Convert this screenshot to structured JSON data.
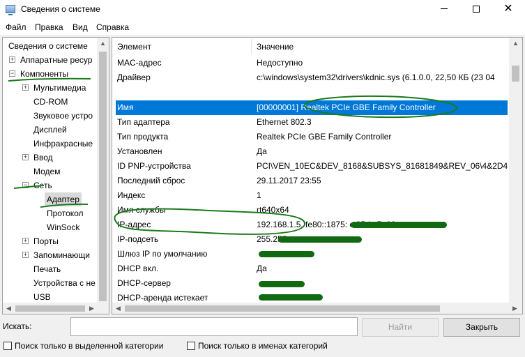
{
  "window": {
    "title": "Сведения о системе"
  },
  "menu": [
    "Файл",
    "Правка",
    "Вид",
    "Справка"
  ],
  "tree": {
    "items": [
      {
        "label": "Сведения о системе",
        "expander": ""
      },
      {
        "label": "Аппаратные ресур",
        "expander": "+"
      },
      {
        "label": "Компоненты",
        "expander": "−"
      },
      {
        "label": "Мультимедиа",
        "expander": "+"
      },
      {
        "label": "CD-ROM",
        "expander": ""
      },
      {
        "label": "Звуковое устро",
        "expander": ""
      },
      {
        "label": "Дисплей",
        "expander": ""
      },
      {
        "label": "Инфракрасные",
        "expander": ""
      },
      {
        "label": "Ввод",
        "expander": "+"
      },
      {
        "label": "Модем",
        "expander": ""
      },
      {
        "label": "Сеть",
        "expander": "−"
      },
      {
        "label": "Адаптер",
        "expander": ""
      },
      {
        "label": "Протокол",
        "expander": ""
      },
      {
        "label": "WinSock",
        "expander": ""
      },
      {
        "label": "Порты",
        "expander": "+"
      },
      {
        "label": "Запоминающи",
        "expander": "+"
      },
      {
        "label": "Печать",
        "expander": ""
      },
      {
        "label": "Устройства с не",
        "expander": ""
      },
      {
        "label": "USB",
        "expander": ""
      }
    ],
    "selected": "Адаптер"
  },
  "list": {
    "columns": [
      "Элемент",
      "Значение"
    ],
    "rows": [
      {
        "name": "MAC-адрес",
        "value": "Недоступно"
      },
      {
        "name": "Драйвер",
        "value": "c:\\windows\\system32\\drivers\\kdnic.sys (6.1.0.0, 22,50 КБ (23 04"
      },
      {
        "name": "",
        "value": ""
      },
      {
        "name": "Имя",
        "value": "[00000001] Realtek PCIe GBE Family Controller"
      },
      {
        "name": "Тип адаптера",
        "value": "Ethernet 802.3"
      },
      {
        "name": "Тип продукта",
        "value": "Realtek PCIe GBE Family Controller"
      },
      {
        "name": "Установлен",
        "value": "Да"
      },
      {
        "name": "ID PNP-устройства",
        "value": "PCI\\VEN_10EC&DEV_8168&SUBSYS_81681849&REV_06\\4&2D4"
      },
      {
        "name": "Последний сброс",
        "value": "29.11.2017 23:55"
      },
      {
        "name": "Индекс",
        "value": "1"
      },
      {
        "name": "Имя службы",
        "value": "rt640x64"
      },
      {
        "name": "IP-адрес",
        "value": "192.168.1.5, fe80::1875:                    c:35da:7e00:ac"
      },
      {
        "name": "IP-подсеть",
        "value": "255.255."
      },
      {
        "name": "Шлюз IP по умолчанию",
        "value": ""
      },
      {
        "name": "DHCP вкл.",
        "value": "Да"
      },
      {
        "name": "DHCP-сервер",
        "value": ""
      },
      {
        "name": "DHCP-аренда истекает",
        "value": ""
      }
    ],
    "selected_row": "Имя"
  },
  "search": {
    "label": "Искать:",
    "value": "",
    "find_button": "Найти",
    "close_button": "Закрыть",
    "option_selected_category": "Поиск только в выделенной категории",
    "option_category_names": "Поиск только в именах категорий"
  },
  "colors": {
    "selection": "#0078d7",
    "annotation": "#1a7a1a"
  }
}
